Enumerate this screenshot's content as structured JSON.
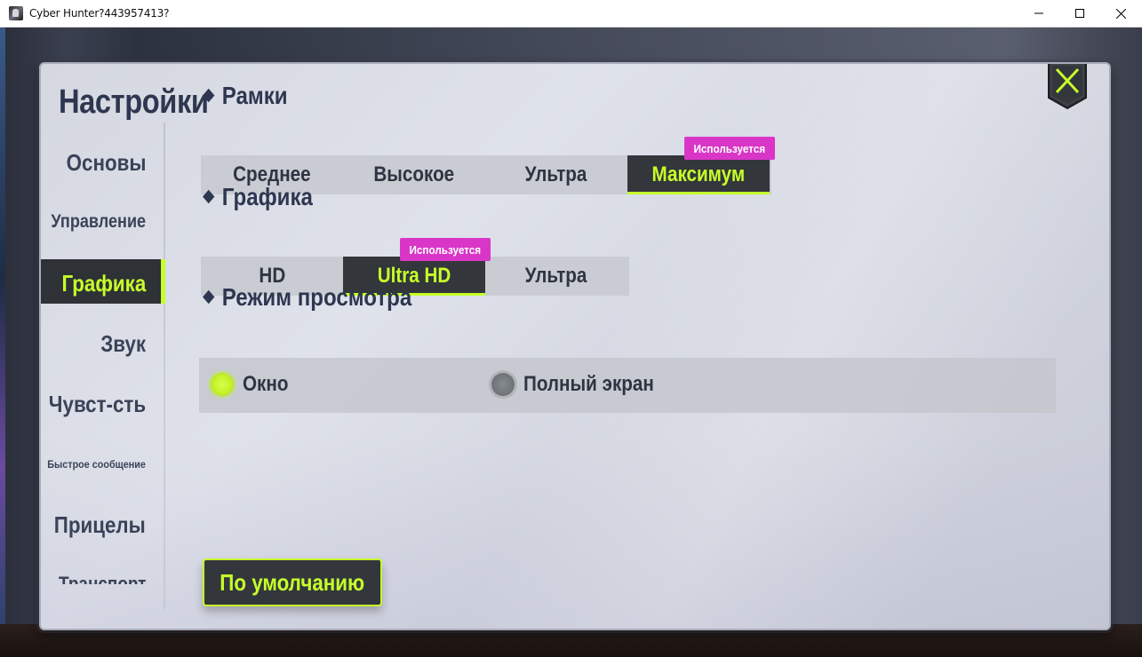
{
  "window": {
    "title": "Cyber Hunter?443957413?",
    "icon": "cyber-hunter-app-icon",
    "controls": [
      "minimize-icon",
      "maximize-icon",
      "close-icon"
    ]
  },
  "settings": {
    "title": "Настройки",
    "close_icon": "x-icon",
    "accent_color": "#c6ff2a",
    "badge_color": "#d936c8"
  },
  "sidebar": {
    "items": [
      {
        "label": "Основы"
      },
      {
        "label": "Управление"
      },
      {
        "label": "Графика",
        "active": true
      },
      {
        "label": "Звук"
      },
      {
        "label": "Чувст-сть"
      },
      {
        "label": "Быстрое сообщение"
      },
      {
        "label": "Прицелы"
      },
      {
        "label": "Транспорт"
      }
    ]
  },
  "frames": {
    "heading": "Рамки",
    "options": [
      {
        "label": "Среднее"
      },
      {
        "label": "Высокое"
      },
      {
        "label": "Ультра"
      },
      {
        "label": "Максимум",
        "selected": true
      }
    ],
    "in_use_badge": "Используется"
  },
  "graphics": {
    "heading": "Графика",
    "options": [
      {
        "label": "HD"
      },
      {
        "label": "Ultra HD",
        "selected": true
      },
      {
        "label": "Ультра"
      }
    ],
    "in_use_badge": "Используется"
  },
  "view_mode": {
    "heading": "Режим просмотра",
    "options": [
      {
        "label": "Окно",
        "selected": true
      },
      {
        "label": "Полный экран",
        "selected": false
      }
    ]
  },
  "default_button": {
    "label": "По умолчанию"
  }
}
